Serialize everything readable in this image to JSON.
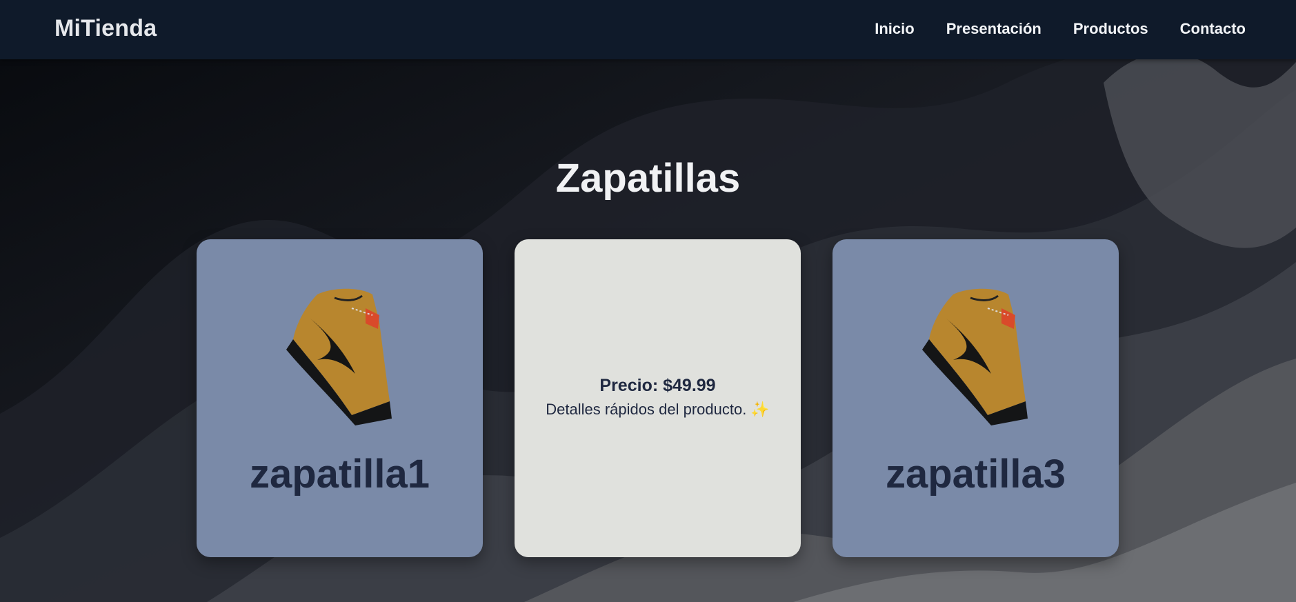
{
  "header": {
    "brand": "MiTienda",
    "nav": [
      "Inicio",
      "Presentación",
      "Productos",
      "Contacto"
    ]
  },
  "main": {
    "title": "Zapatillas",
    "cards": [
      {
        "name": "zapatilla1",
        "image_icon": "sneaker-image"
      },
      {
        "price": "Precio: $49.99",
        "description": "Detalles rápidos del producto.",
        "emoji": "✨"
      },
      {
        "name": "zapatilla3",
        "image_icon": "sneaker-image"
      }
    ]
  },
  "colors": {
    "navbar": "#0f1a2a",
    "card_blue": "#7a8aa8",
    "card_light": "#e0e1dd",
    "card_text": "#1f2840"
  }
}
